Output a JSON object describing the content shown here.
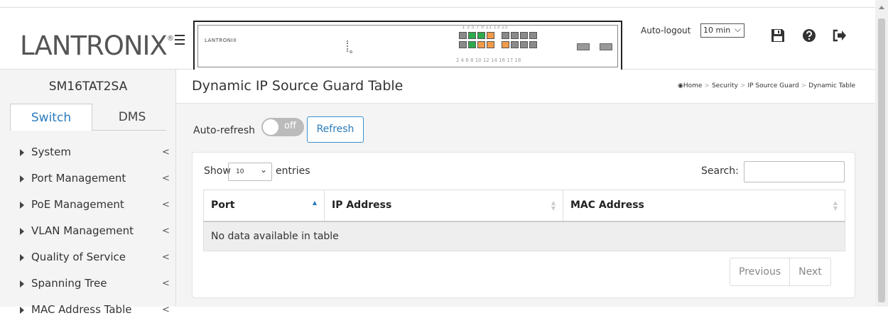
{
  "header": {
    "logo_text": "LANTRONIX",
    "logo_mark": "®",
    "panel_brand": "LANTRONIX",
    "ports_top": "1 3 5 7 9 11 13 15",
    "ports_bottom": "2 4 6 8 10 12 14 16 17 18",
    "autologout_label": "Auto-logout",
    "autologout_value": "10 min"
  },
  "sidebar": {
    "device_name": "SM16TAT2SA",
    "tabs": [
      {
        "label": "Switch"
      },
      {
        "label": "DMS"
      }
    ],
    "items": [
      {
        "label": "System"
      },
      {
        "label": "Port Management"
      },
      {
        "label": "PoE Management"
      },
      {
        "label": "VLAN Management"
      },
      {
        "label": "Quality of Service"
      },
      {
        "label": "Spanning Tree"
      },
      {
        "label": "MAC Address Table"
      }
    ]
  },
  "page": {
    "title": "Dynamic IP Source Guard Table",
    "breadcrumb": [
      "Home",
      "Security",
      "IP Source Guard",
      "Dynamic Table"
    ]
  },
  "controls": {
    "autorefresh_label": "Auto-refresh",
    "toggle_state": "off",
    "refresh_label": "Refresh"
  },
  "table": {
    "show_label": "Show",
    "entries_label": "entries",
    "length_value": "10",
    "search_label": "Search:",
    "columns": [
      "Port",
      "IP Address",
      "MAC Address"
    ],
    "empty_message": "No data available in table",
    "prev_label": "Previous",
    "next_label": "Next"
  },
  "colors": {
    "brand_orange": "#f08a24",
    "accent_blue": "#2a7bbd",
    "port_green": "#2eaa4c",
    "port_orange": "#f39a4a",
    "port_gray": "#8a8a8a"
  }
}
